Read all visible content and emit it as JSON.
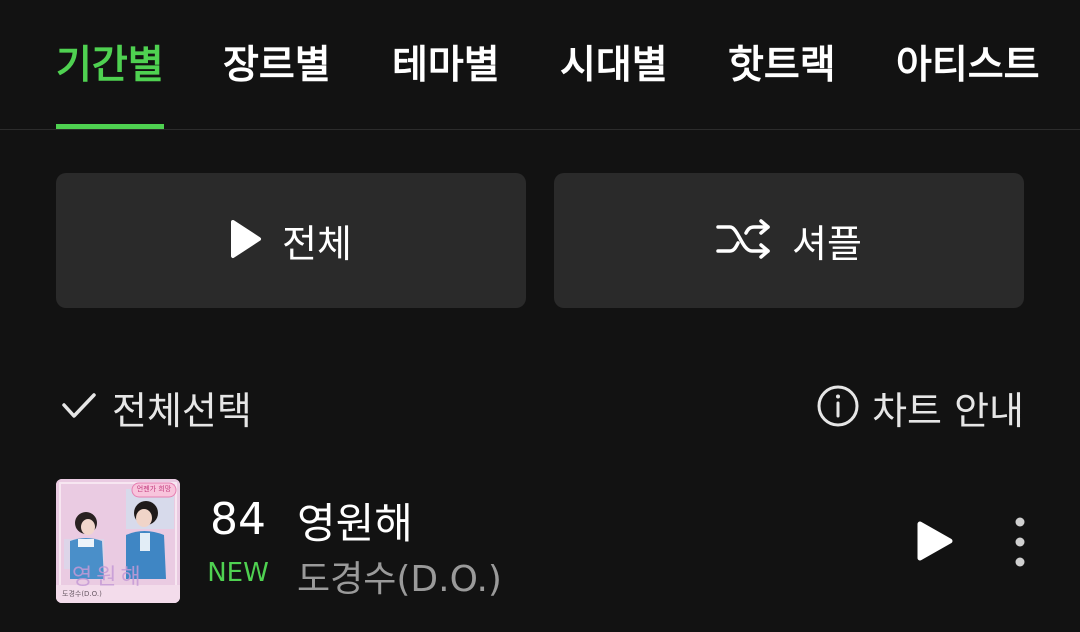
{
  "tabs": [
    {
      "label": "기간별",
      "active": true
    },
    {
      "label": "장르별",
      "active": false
    },
    {
      "label": "테마별",
      "active": false
    },
    {
      "label": "시대별",
      "active": false
    },
    {
      "label": "핫트랙",
      "active": false
    },
    {
      "label": "아티스트",
      "active": false
    }
  ],
  "buttons": {
    "play_all_label": "전체",
    "shuffle_label": "셔플"
  },
  "list_controls": {
    "select_all_label": "전체선택",
    "chart_info_label": "차트 안내"
  },
  "songs": [
    {
      "rank": "84",
      "rank_change": "NEW",
      "title": "영원해",
      "artist": "도경수(D.O.)",
      "cover_text": "영원해",
      "cover_badge": "언젠가 희망",
      "cover_artist": "도경수(D.O.)"
    }
  ],
  "colors": {
    "accent": "#4fd151",
    "background": "#121212",
    "button_bg": "#2a2a2a",
    "secondary_text": "#9a9a9a"
  },
  "icons": {
    "play": "play-icon",
    "shuffle": "shuffle-icon",
    "check": "check-icon",
    "info": "info-icon",
    "more": "more-vertical-icon"
  }
}
